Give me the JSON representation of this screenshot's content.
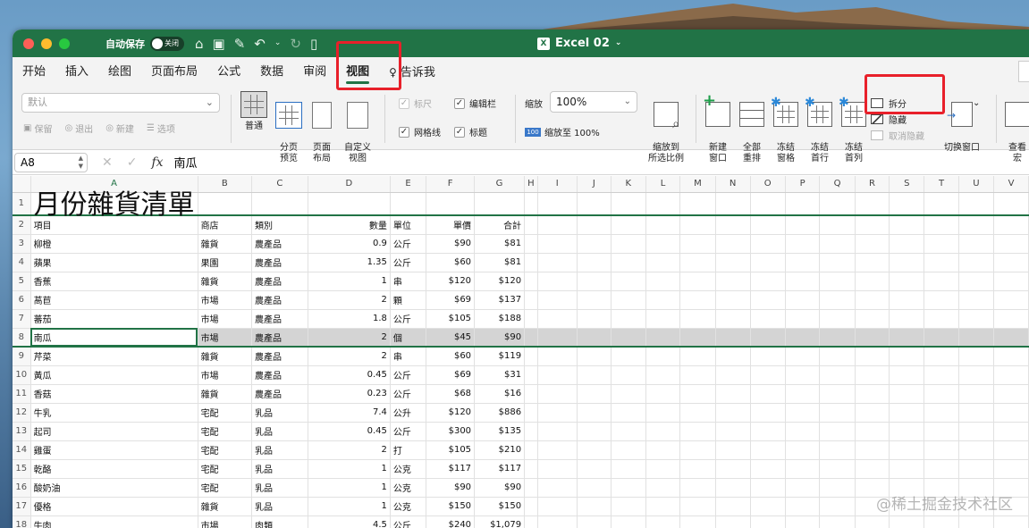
{
  "window": {
    "title": "Excel 02",
    "autosave_label": "自动保存",
    "autosave_state": "关闭"
  },
  "tabs": [
    "开始",
    "插入",
    "绘图",
    "页面布局",
    "公式",
    "数据",
    "审阅",
    "视图",
    "告诉我"
  ],
  "active_tab": "视图",
  "ribbon": {
    "sheet_view_select": "默认",
    "sheet_view_actions": [
      "保留",
      "退出",
      "新建",
      "选项"
    ],
    "workbook_views": [
      "普通",
      "分页\n预览",
      "页面\n布局",
      "自定义\n视图"
    ],
    "show_options": {
      "ruler": "标尺",
      "formula_bar": "编辑栏",
      "gridlines": "网格线",
      "headings": "标题"
    },
    "zoom_label": "缩放",
    "zoom_value": "100%",
    "zoom_100": "缩放至 100%",
    "zoom_selection": "缩放到\n所选比例",
    "window_buttons": [
      "新建\n窗口",
      "全部\n重排",
      "冻结\n窗格",
      "冻结\n首行",
      "冻结\n首列"
    ],
    "split": "拆分",
    "hide": "隐藏",
    "unhide": "取消隐藏",
    "switch_window": "切换窗口",
    "macros": "查看\n宏"
  },
  "formula_bar": {
    "name_box": "A8",
    "fx": "fx",
    "content": "南瓜"
  },
  "columns": [
    "A",
    "B",
    "C",
    "D",
    "E",
    "F",
    "G",
    "H",
    "I",
    "J",
    "K",
    "L",
    "M",
    "N",
    "O",
    "P",
    "Q",
    "R",
    "S",
    "T",
    "U",
    "V"
  ],
  "sheet_title": "月份雜貨清單",
  "headers": [
    "項目",
    "商店",
    "類別",
    "數量",
    "單位",
    "單價",
    "合計"
  ],
  "rows": [
    [
      "柳橙",
      "雜貨",
      "農產品",
      "0.9",
      "公斤",
      "$90",
      "$81"
    ],
    [
      "蘋果",
      "果園",
      "農產品",
      "1.35",
      "公斤",
      "$60",
      "$81"
    ],
    [
      "香蕉",
      "雜貨",
      "農產品",
      "1",
      "串",
      "$120",
      "$120"
    ],
    [
      "萵苣",
      "市場",
      "農產品",
      "2",
      "顆",
      "$69",
      "$137"
    ],
    [
      "蕃茄",
      "市場",
      "農產品",
      "1.8",
      "公斤",
      "$105",
      "$188"
    ],
    [
      "南瓜",
      "市場",
      "農產品",
      "2",
      "個",
      "$45",
      "$90"
    ],
    [
      "芹菜",
      "雜貨",
      "農產品",
      "2",
      "串",
      "$60",
      "$119"
    ],
    [
      "黃瓜",
      "市場",
      "農產品",
      "0.45",
      "公斤",
      "$69",
      "$31"
    ],
    [
      "香菇",
      "雜貨",
      "農產品",
      "0.23",
      "公斤",
      "$68",
      "$16"
    ],
    [
      "牛乳",
      "宅配",
      "乳品",
      "7.4",
      "公升",
      "$120",
      "$886"
    ],
    [
      "起司",
      "宅配",
      "乳品",
      "0.45",
      "公斤",
      "$300",
      "$135"
    ],
    [
      "雞蛋",
      "宅配",
      "乳品",
      "2",
      "打",
      "$105",
      "$210"
    ],
    [
      "乾酪",
      "宅配",
      "乳品",
      "1",
      "公克",
      "$117",
      "$117"
    ],
    [
      "酸奶油",
      "宅配",
      "乳品",
      "1",
      "公克",
      "$90",
      "$90"
    ],
    [
      "優格",
      "雜貨",
      "乳品",
      "1",
      "公克",
      "$150",
      "$150"
    ],
    [
      "牛肉",
      "市場",
      "肉類",
      "4.5",
      "公斤",
      "$240",
      "$1,079"
    ]
  ],
  "watermark": "@稀土掘金技术社区"
}
